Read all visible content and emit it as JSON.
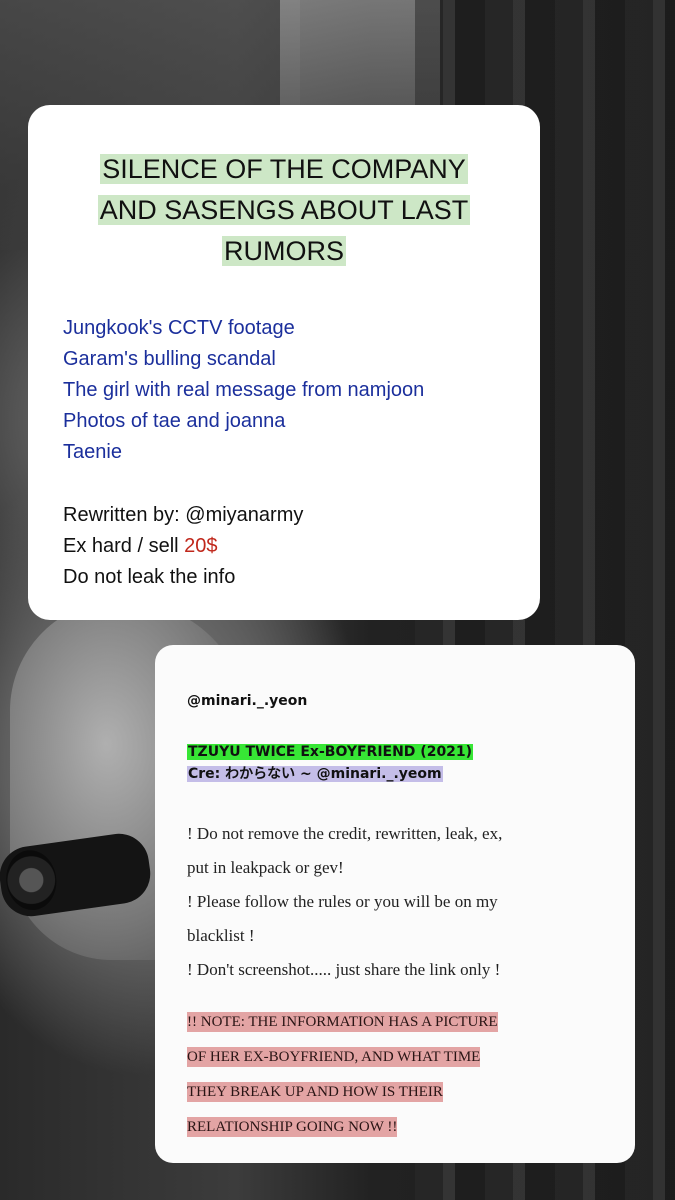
{
  "card1": {
    "title_lines": [
      "SILENCE OF THE COMPANY",
      "AND SASENGS ABOUT LAST",
      "RUMORS"
    ],
    "topics": [
      "Jungkook's CCTV footage",
      "Garam's bulling scandal",
      "The girl with real message from namjoon",
      "Photos of tae and joanna",
      "Taenie"
    ],
    "rewritten": "Rewritten by: @miyanarmy",
    "ex_label": "Ex hard / sell ",
    "price": "20$",
    "leak_notice": "Do not leak the info",
    "colors": {
      "title_highlight": "#cde7c6",
      "topics": "#1b2f9c",
      "price": "#c0271b"
    }
  },
  "card2": {
    "handle": "@minari._.yeon",
    "headline": "TZUYU TWICE Ex-BOYFRIEND (2021)",
    "credit": "Cre: わからない ~ @minari._.yeom",
    "rules_lines": [
      "! Do not remove the credit, rewritten, leak, ex,",
      "put in leakpack or gev!",
      "! Please follow the rules or you will be on my",
      "blacklist !",
      "! Don't screenshot.....  just share the link only !"
    ],
    "note_lines": [
      "!! NOTE: THE INFORMATION HAS A PICTURE",
      "OF HER EX-BOYFRIEND, AND WHAT TIME",
      "THEY BREAK UP AND HOW IS THEIR",
      "RELATIONSHIP GOING NOW !!"
    ],
    "colors": {
      "headline_bg": "#37e635",
      "credit_bg": "#c4bde8",
      "note_bg": "#e3a4a4"
    }
  },
  "icons": {
    "background": "photo-background"
  }
}
